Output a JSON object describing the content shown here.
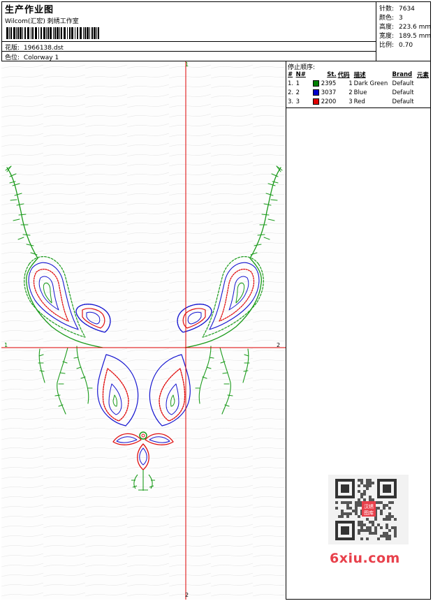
{
  "header": {
    "title": "生产作业图",
    "company": "Wilcom(汇宏) 刺绣工作室",
    "design_label": "花版:",
    "design_value": "1966138.dst",
    "colorway_label": "色位:",
    "colorway_value": "Colorway 1"
  },
  "stats": [
    {
      "label": "针数:",
      "value": "7634"
    },
    {
      "label": "颜色:",
      "value": "3"
    },
    {
      "label": "高度:",
      "value": "223.6 mm"
    },
    {
      "label": "宽度:",
      "value": "189.5 mm"
    },
    {
      "label": "比例:",
      "value": "0.70"
    }
  ],
  "stop_sequence": {
    "title": "停止顺序:",
    "columns": [
      "#",
      "N#",
      "St.",
      "代码",
      "描述",
      "Brand",
      "元素"
    ],
    "rows": [
      {
        "idx": "1.",
        "n": "1",
        "color": "#008000",
        "st": "2395",
        "code": "1",
        "desc": "Dark Green",
        "brand": "Default"
      },
      {
        "idx": "2.",
        "n": "2",
        "color": "#0000cc",
        "st": "3037",
        "code": "2",
        "desc": "Blue",
        "brand": "Default"
      },
      {
        "idx": "3.",
        "n": "3",
        "color": "#e00000",
        "st": "2200",
        "code": "3",
        "desc": "Red",
        "brand": "Default"
      }
    ]
  },
  "axes": {
    "top": "1",
    "bottom": "2",
    "left": "1",
    "right": "2",
    "color": "#dd0000"
  },
  "watermark": {
    "brand": "6xiu.com",
    "stamp": "汉绣图库",
    "accent": "#e8404b"
  },
  "thread_colors": {
    "green": "#1a9a1a",
    "blue": "#1515d0",
    "red": "#e01010"
  }
}
